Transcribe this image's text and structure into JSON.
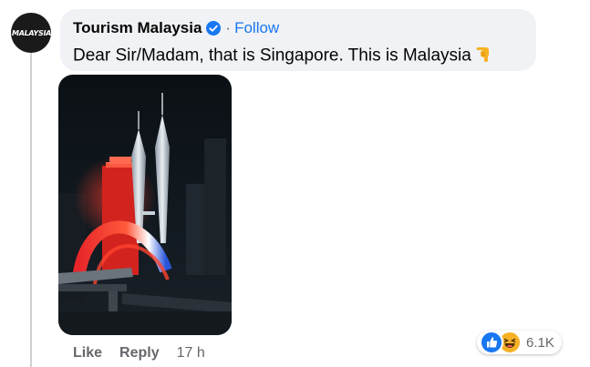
{
  "comment": {
    "author": "Tourism Malaysia",
    "separator": "·",
    "follow_label": "Follow",
    "text": "Dear Sir/Madam, that is Singapore. This is Malaysia",
    "avatar_text": "MALAYSIA",
    "emoji": "backhand-index-pointing-down",
    "verified_icon": "verified-badge-icon",
    "photo_subject": "Petronas Twin Towers night photo"
  },
  "actions": {
    "like_label": "Like",
    "reply_label": "Reply",
    "time": "17 h"
  },
  "reactions": {
    "icons": [
      "like-reaction-icon",
      "haha-reaction-icon"
    ],
    "count": "6.1K"
  },
  "colors": {
    "bubble": "#f0f2f5",
    "link": "#1877f2",
    "muted": "#65676b",
    "text": "#050505"
  }
}
